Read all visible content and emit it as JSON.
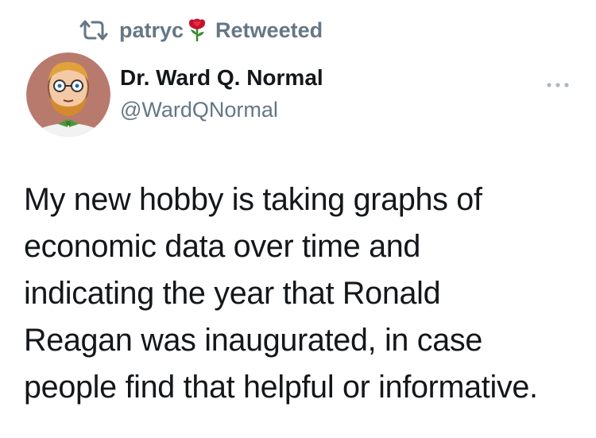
{
  "retweet_header": {
    "icon": "retweet-icon",
    "user": "patryc",
    "emoji": "rose-icon",
    "label": "Retweeted",
    "color": "#657786"
  },
  "author": {
    "display_name": "Dr. Ward Q. Normal",
    "handle": "@WardQNormal",
    "avatar": "cartoon-face-avatar"
  },
  "more_menu": {
    "icon": "more-options-icon"
  },
  "tweet": {
    "text_lines": [
      "My new hobby is taking graphs of",
      "economic data over time and",
      "indicating the year that Ronald",
      "Reagan was inaugurated, in case",
      "people find that helpful or informative."
    ]
  }
}
